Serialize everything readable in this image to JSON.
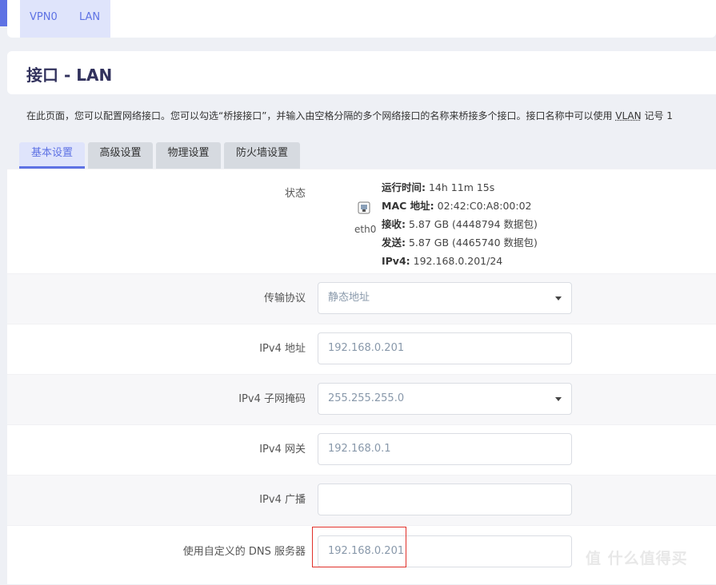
{
  "top_nav": {
    "tabs": [
      "VPN0",
      "LAN"
    ]
  },
  "header": {
    "title": "接口 - LAN"
  },
  "description": {
    "text": "在此页面，您可以配置网络接口。您可以勾选“桥接接口”，并输入由空格分隔的多个网络接口的名称来桥接多个接口。接口名称中可以使用 ",
    "vlan": "VLAN",
    "suffix": " 记号 1"
  },
  "section_tabs": [
    "基本设置",
    "高级设置",
    "物理设置",
    "防火墙设置"
  ],
  "status": {
    "label": "状态",
    "device": "eth0",
    "uptime_label": "运行时间:",
    "uptime": "14h 11m 15s",
    "mac_label": "MAC 地址:",
    "mac": "02:42:C0:A8:00:02",
    "rx_label": "接收:",
    "rx": "5.87 GB (4448794 数据包)",
    "tx_label": "发送:",
    "tx": "5.87 GB (4465740 数据包)",
    "ipv4_label": "IPv4:",
    "ipv4": "192.168.0.201/24"
  },
  "fields": {
    "protocol": {
      "label": "传输协议",
      "value": "静态地址"
    },
    "ipv4_addr": {
      "label": "IPv4 地址",
      "value": "192.168.0.201"
    },
    "netmask": {
      "label": "IPv4 子网掩码",
      "value": "255.255.255.0"
    },
    "gateway": {
      "label": "IPv4 网关",
      "value": "192.168.0.1"
    },
    "broadcast": {
      "label": "IPv4 广播",
      "value": ""
    },
    "dns": {
      "label": "使用自定义的 DNS 服务器",
      "value": "192.168.0.201"
    }
  },
  "watermark": "值 什么值得买"
}
